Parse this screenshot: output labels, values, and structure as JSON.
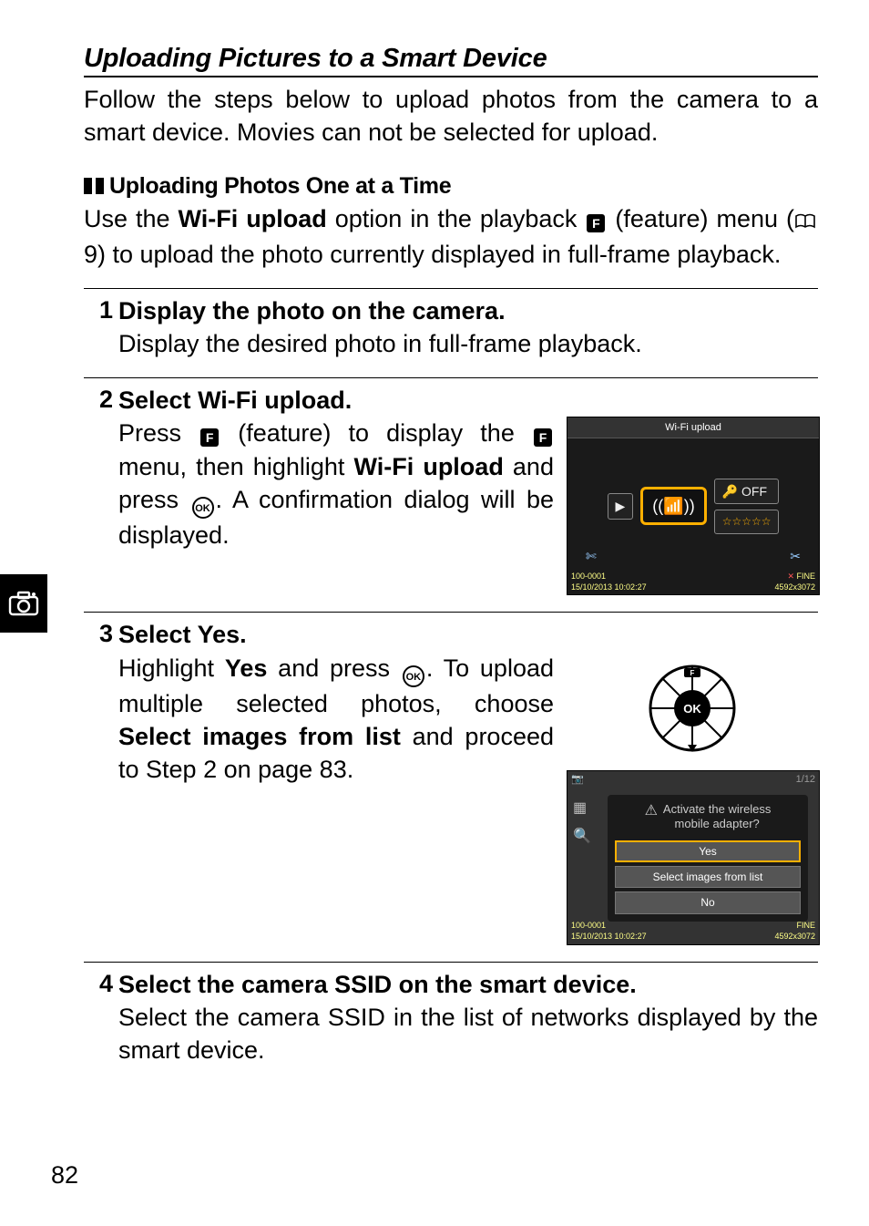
{
  "heading": "Uploading Pictures to a Smart Device",
  "intro": "Follow the steps below to upload photos from the camera to a smart device. Movies can not be selected for upload.",
  "sub_heading": "Uploading Photos One at a Time",
  "sub_body_pre": "Use the ",
  "sub_body_bold": "Wi-Fi upload",
  "sub_body_mid": " option in the playback ",
  "sub_body_post": " (feature) menu (",
  "sub_body_ref": " 9) to upload the photo currently displayed in full-frame playback.",
  "steps": {
    "s1": {
      "num": "1",
      "title": "Display the photo on the camera.",
      "text": "Display the desired photo in full-frame playback."
    },
    "s2": {
      "num": "2",
      "title_pre": "Select ",
      "title_bold": "Wi-Fi upload",
      "title_post": ".",
      "t1": "Press ",
      "t2": " (feature) to display the ",
      "t3": " menu, then highlight ",
      "t3b": "Wi-Fi upload",
      "t4": " and press ",
      "t5": ". A confirmation dialog will be displayed."
    },
    "s3": {
      "num": "3",
      "title_pre": "Select ",
      "title_bold": "Yes",
      "title_post": ".",
      "t1": "Highlight ",
      "t1b": "Yes",
      "t2": " and press ",
      "t3": ". To upload multiple selected photos, choose ",
      "t3b": "Select images from list",
      "t4": " and proceed to Step 2 on page 83."
    },
    "s4": {
      "num": "4",
      "title": "Select the camera SSID on the smart device.",
      "text": "Select the camera SSID in the list of networks displayed by the smart device."
    }
  },
  "lcd1": {
    "title": "Wi-Fi upload",
    "off": "OFF",
    "stars": "☆☆☆☆☆",
    "file": "100-0001",
    "date": "15/10/2013 10:02:27",
    "size": "4592x3072",
    "fine": "FINE"
  },
  "dialog": {
    "counter": "1/12",
    "msg_line1": "Activate the wireless",
    "msg_line2": "mobile adapter?",
    "yes": "Yes",
    "sel_list": "Select images from list",
    "no": "No",
    "file": "100-0001",
    "date": "15/10/2013 10:02:27",
    "size": "4592x3072",
    "fine": "FINE"
  },
  "page_number": "82",
  "icons": {
    "feature_letter": "F",
    "ok_letter": "OK"
  }
}
